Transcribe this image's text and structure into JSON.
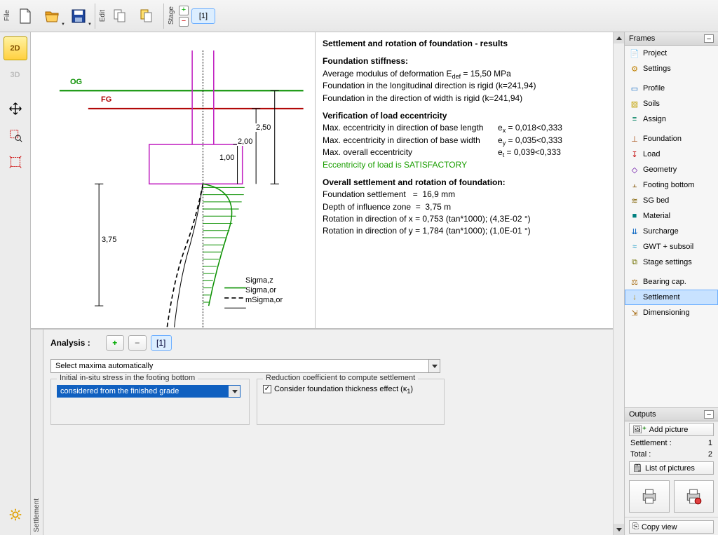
{
  "toolbar": {
    "file_label": "File",
    "edit_label": "Edit",
    "stage_label": "Stage",
    "stage_number": "[1]"
  },
  "view_tools": {
    "btn_2d": "2D",
    "btn_3d": "3D"
  },
  "drawing": {
    "label_og": "OG",
    "label_fg": "FG",
    "dim_250": "2,50",
    "dim_200": "2,00",
    "dim_100": "1,00",
    "dim_375": "3,75",
    "legend": {
      "sigmaz": "Sigma,z",
      "sigmaor": "Sigma,or",
      "msigmaor": "mSigma,or"
    }
  },
  "results": {
    "title": "Settlement and rotation of foundation - results",
    "h_stiff": "Foundation stiffness:",
    "l_edf": "Average modulus of deformation E",
    "l_edf_sub": "def",
    "v_edf": " = 15,50 MPa",
    "l_long": "Foundation in the longitudinal direction is rigid (k=241,94)",
    "l_width": "Foundation in the direction of width is rigid (k=241,94)",
    "h_ecc": "Verification of load eccentricity",
    "ecc_len": "Max. eccentricity in direction of base length",
    "ecc_wid": "Max. eccentricity in direction of base width",
    "ecc_ov": "Max. overall eccentricity",
    "ex_lbl": "e",
    "ex_sub": "x",
    "ex_val": " =  0,018<0,333",
    "ey_lbl": "e",
    "ey_sub": "y",
    "ey_val": " =  0,035<0,333",
    "et_lbl": "e",
    "et_sub": "t",
    "et_val": " =  0,039<0,333",
    "ecc_ok": "Eccentricity of load is SATISFACTORY",
    "h_set": "Overall settlement and rotation of foundation:",
    "set_l": "Foundation settlement   =  16,9 mm",
    "depth_l": "Depth of influence zone  =  3,75 m",
    "rotx": "Rotation in direction of x = 0,753 (tan*1000); (4,3E-02 °)",
    "roty": "Rotation in direction of y = 1,784 (tan*1000); (1,0E-01 °)"
  },
  "analysis": {
    "label": "Analysis :",
    "num": "[1]",
    "combo_main": "Select maxima automatically",
    "group1_title": "Initial in-situ stress in the footing bottom",
    "group1_value": "considered from the finished grade",
    "group2_title": "Reduction coefficient to compute settlement",
    "chk_label_a": "Consider foundation thickness effect (κ",
    "chk_label_sub": "1",
    "chk_label_b": ")"
  },
  "sidebar_label": "Settlement",
  "frames": {
    "title": "Frames",
    "items": [
      {
        "label": "Project",
        "icon": "doc"
      },
      {
        "label": "Settings",
        "icon": "gear"
      },
      {
        "sep": true
      },
      {
        "label": "Profile",
        "icon": "profile"
      },
      {
        "label": "Soils",
        "icon": "soils"
      },
      {
        "label": "Assign",
        "icon": "assign"
      },
      {
        "sep": true
      },
      {
        "label": "Foundation",
        "icon": "found"
      },
      {
        "label": "Load",
        "icon": "load"
      },
      {
        "label": "Geometry",
        "icon": "geom"
      },
      {
        "label": "Footing bottom",
        "icon": "footing"
      },
      {
        "label": "SG bed",
        "icon": "sgbed"
      },
      {
        "label": "Material",
        "icon": "mat"
      },
      {
        "label": "Surcharge",
        "icon": "surch"
      },
      {
        "label": "GWT + subsoil",
        "icon": "gwt"
      },
      {
        "label": "Stage settings",
        "icon": "stage"
      },
      {
        "sep": true
      },
      {
        "label": "Bearing cap.",
        "icon": "bc"
      },
      {
        "label": "Settlement",
        "icon": "settle",
        "selected": true
      },
      {
        "label": "Dimensioning",
        "icon": "dim"
      }
    ]
  },
  "outputs": {
    "title": "Outputs",
    "add_pic": "Add picture",
    "settlement_l": "Settlement :",
    "settlement_v": "1",
    "total_l": "Total :",
    "total_v": "2",
    "list_pic": "List of pictures",
    "copy_view": "Copy view"
  }
}
